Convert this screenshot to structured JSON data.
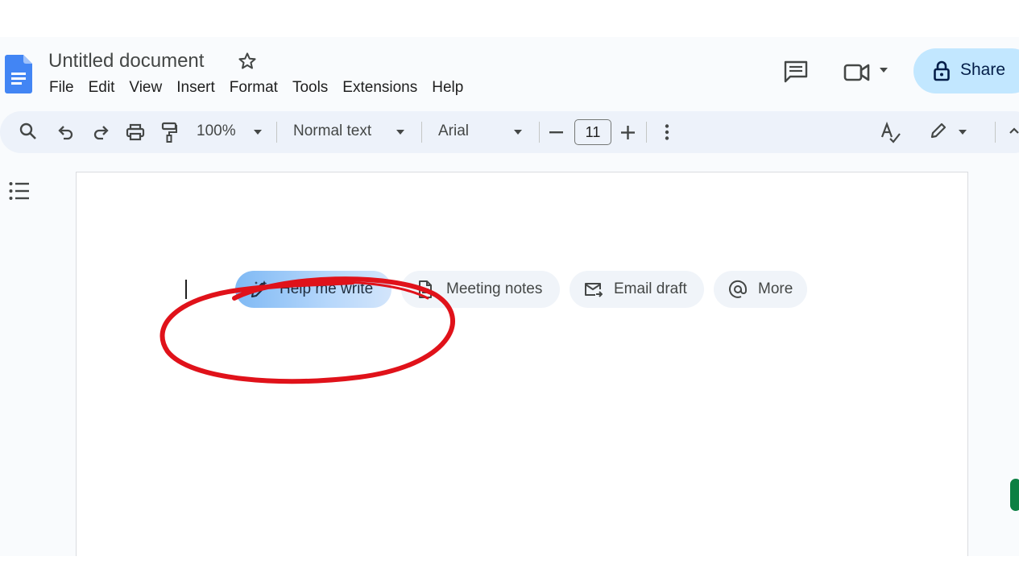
{
  "document": {
    "title": "Untitled document",
    "menu": [
      "File",
      "Edit",
      "View",
      "Insert",
      "Format",
      "Tools",
      "Extensions",
      "Help"
    ]
  },
  "header": {
    "share_label": "Share"
  },
  "toolbar": {
    "zoom": "100%",
    "style": "Normal text",
    "font": "Arial",
    "font_size": "11"
  },
  "smart_chips": [
    {
      "label": "Help me write",
      "icon": "pen-sparkle-icon"
    },
    {
      "label": "Meeting notes",
      "icon": "document-icon"
    },
    {
      "label": "Email draft",
      "icon": "email-icon"
    },
    {
      "label": "More",
      "icon": "at-sign-icon"
    }
  ],
  "colors": {
    "accent": "#0b57d0",
    "share_bg": "#c2e7ff",
    "toolbar_bg": "#edf2fa",
    "annotation": "#e0121a"
  }
}
